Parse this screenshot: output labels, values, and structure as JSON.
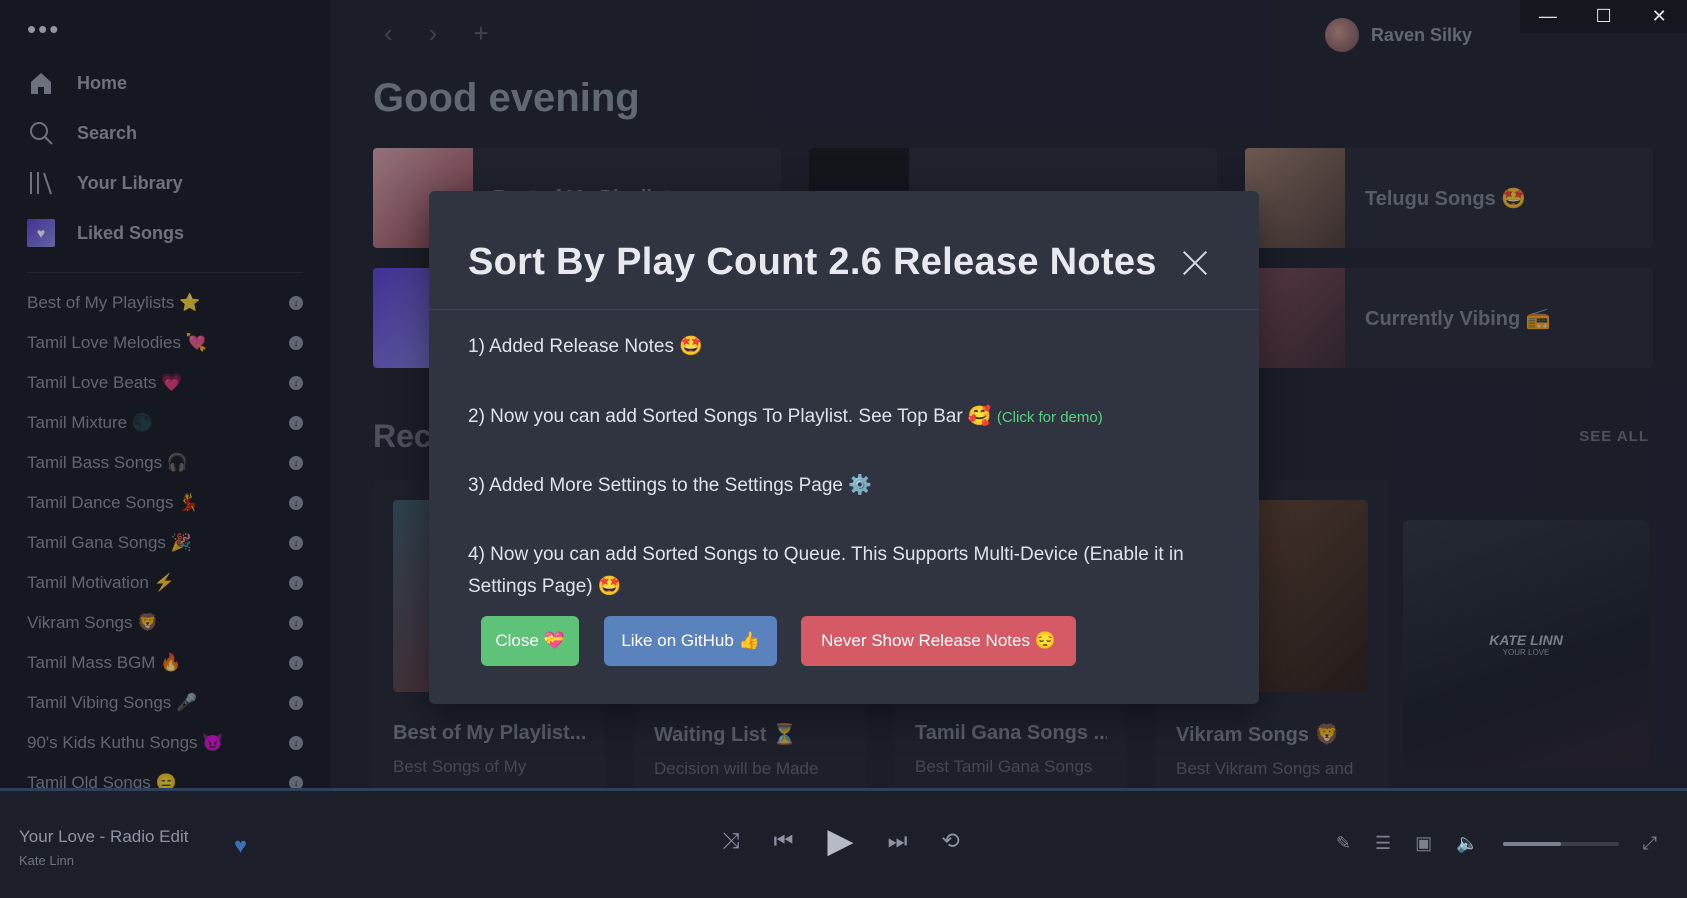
{
  "window": {
    "minimize": "—",
    "maximize": "☐",
    "close": "✕"
  },
  "sidebar": {
    "menu_dots": "•••",
    "nav": [
      {
        "label": "Home",
        "icon": "home-icon"
      },
      {
        "label": "Search",
        "icon": "search-icon"
      },
      {
        "label": "Your Library",
        "icon": "library-icon"
      },
      {
        "label": "Liked Songs",
        "icon": "liked-songs-icon"
      }
    ],
    "playlists": [
      "Best of My Playlists ⭐",
      "Tamil Love Melodies 💘",
      "Tamil Love Beats 💗",
      "Tamil Mixture 🌑",
      "Tamil Bass Songs 🎧",
      "Tamil Dance Songs 💃",
      "Tamil Gana Songs 🎉",
      "Tamil Motivation ⚡",
      "Vikram Songs 🦁",
      "Tamil Mass BGM 🔥",
      "Tamil Vibing Songs 🎤",
      "90's Kids Kuthu Songs 😈",
      "Tamil Old Songs 😑"
    ]
  },
  "header": {
    "back": "‹",
    "forward": "›",
    "add": "+",
    "user_name": "Raven Silky"
  },
  "main": {
    "greeting": "Good evening",
    "tiles": [
      {
        "title": "Best of My Playlists"
      },
      {
        "title": ""
      },
      {
        "title": "Telugu Songs 🤩"
      },
      {
        "title": ""
      },
      {
        "title": ""
      },
      {
        "title": "Currently Vibing 📻"
      }
    ],
    "recent_heading": "Reco",
    "see_all": "SEE ALL",
    "cards": [
      {
        "title": "Best of My Playlist...",
        "desc": "Best Songs of My"
      },
      {
        "title": "Waiting List ⏳",
        "desc": "Decision will be Made"
      },
      {
        "title": "Tamil Gana Songs ...",
        "desc": "Best Tamil Gana Songs"
      },
      {
        "title": "Vikram Songs 🦁",
        "desc": "Best Vikram Songs and"
      }
    ],
    "now_playing_art": {
      "artist": "KATE LINN",
      "song": "YOUR LOVE"
    }
  },
  "modal": {
    "title": "Sort By Play Count 2.6 Release Notes",
    "notes": [
      "1) Added Release Notes 🤩",
      "2) Now you can add Sorted Songs To Playlist. See Top Bar 🥰",
      "3) Added More Settings to the Settings Page ⚙️",
      "4) Now you can add Sorted Songs to Queue. This Supports Multi-Device (Enable it in Settings Page) 🤩"
    ],
    "demo_link": "(Click for demo)",
    "buttons": {
      "close": "Close 💝",
      "github": "Like on GitHub 👍",
      "never": "Never Show Release Notes 😔"
    }
  },
  "player": {
    "track_name": "Your Love - Radio Edit",
    "artist": "Kate Linn",
    "volume": 0.5,
    "progress": 0.95
  }
}
